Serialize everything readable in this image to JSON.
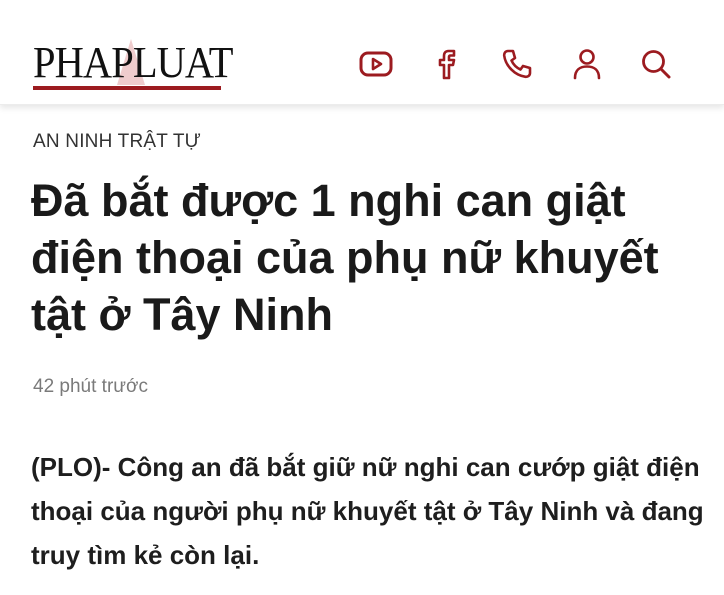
{
  "header": {
    "logo_text": "PHAPLUAT",
    "brand_color": "#9c1b20",
    "icons": [
      "youtube-icon",
      "facebook-icon",
      "phone-icon",
      "user-icon",
      "search-icon"
    ]
  },
  "article": {
    "category": "AN NINH TRẬT TỰ",
    "title": "Đã bắt được 1 nghi can giật điện thoại của phụ nữ khuyết tật ở Tây Ninh",
    "time": "42 phút trước",
    "lead": "(PLO)- Công an đã bắt giữ nữ nghi can cướp giật điện thoại của người phụ nữ khuyết tật ở Tây Ninh và đang truy tìm kẻ còn lại."
  }
}
